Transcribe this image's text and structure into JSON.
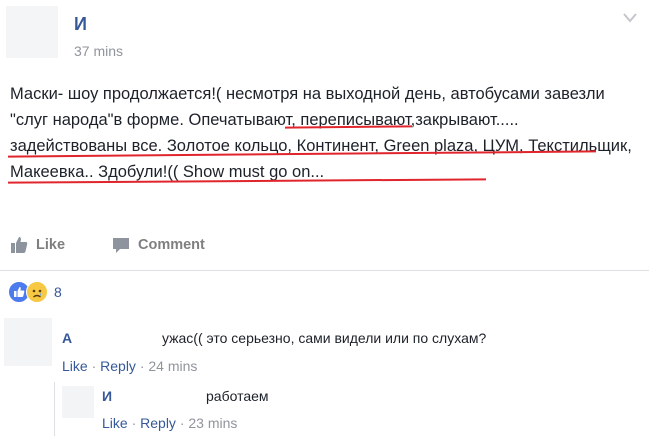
{
  "post": {
    "author": "И",
    "timestamp": "37 mins",
    "text_parts": {
      "p1": "Маски- шоу продолжается!( несмотря на выходной день, автобусами завезли \"слуг народа\"в форме. ",
      "p2": "Опечатывают, переписывают,закрывают..... задействованы все.",
      "p3": " ",
      "p4": "Золотое кольцо, Континент, Green plaza, ЦУМ, Текстильщик, Макеевка..",
      "p5": " Здобули!(( Show must go on..."
    },
    "underline_color": "#e0252c"
  },
  "actions": {
    "like_label": "Like",
    "comment_label": "Comment"
  },
  "reactions": {
    "count": "8"
  },
  "comments": [
    {
      "author": "А",
      "text": "ужас(( это серьезно, сами видели или по слухам?",
      "like_label": "Like",
      "reply_label": "Reply",
      "sep": "·",
      "time": "24 mins"
    },
    {
      "author": "И",
      "text": "работаем",
      "like_label": "Like",
      "reply_label": "Reply",
      "sep": "·",
      "time": "23 mins"
    }
  ],
  "colors": {
    "link": "#365899",
    "meta": "#90949c",
    "text": "#1d2129",
    "accent_like": "#4b7bec"
  },
  "icons": {
    "chevron": "chevron-down-icon",
    "like": "thumbs-up-icon",
    "comment": "comment-bubble-icon",
    "react_like": "like-reaction-icon",
    "react_sad": "sad-reaction-icon"
  }
}
